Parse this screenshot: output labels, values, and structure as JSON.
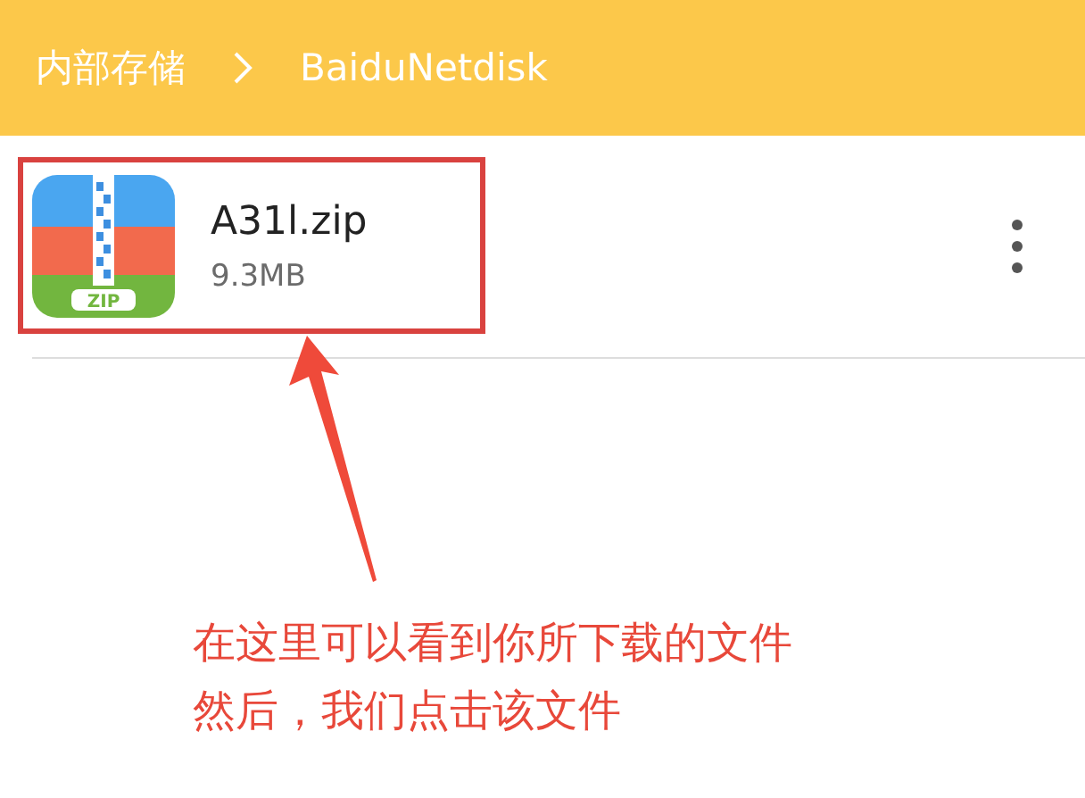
{
  "breadcrumb": [
    {
      "label": "内部存储"
    },
    {
      "label": "BaiduNetdisk"
    }
  ],
  "files": [
    {
      "name": "A31l.zip",
      "size": "9.3MB",
      "icon_label": "ZIP",
      "highlighted": true
    }
  ],
  "annotation": {
    "lines": [
      "在这里可以看到你所下载的文件",
      "然后，我们点击该文件"
    ]
  }
}
